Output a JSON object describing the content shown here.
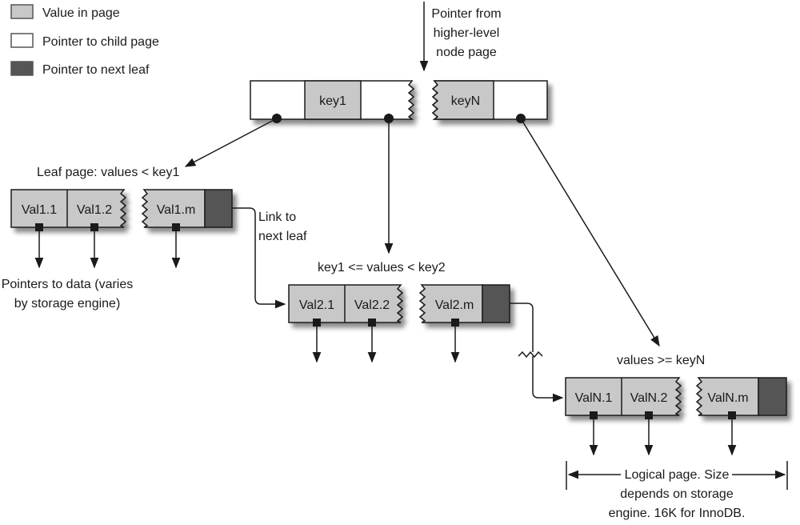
{
  "legend": {
    "items": [
      {
        "label": "Value in page",
        "swatch": "#c8c8c8"
      },
      {
        "label": "Pointer to child page",
        "swatch": "#ffffff"
      },
      {
        "label": "Pointer to next leaf",
        "swatch": "#555555"
      }
    ]
  },
  "colors": {
    "value_fill": "#c8c8c8",
    "pointer_fill": "#ffffff",
    "next_leaf_fill": "#555555",
    "stroke": "#1a1a1a"
  },
  "root": {
    "incoming_label": [
      "Pointer from",
      "higher-level",
      "node page"
    ],
    "keys": [
      "key1",
      "keyN"
    ]
  },
  "leaves": [
    {
      "title": "Leaf page: values < key1",
      "values": [
        "Val1.1",
        "Val1.2",
        "Val1.m"
      ]
    },
    {
      "title": "key1 <= values < key2",
      "values": [
        "Val2.1",
        "Val2.2",
        "Val2.m"
      ]
    },
    {
      "title": "values >= keyN",
      "values": [
        "ValN.1",
        "ValN.2",
        "ValN.m"
      ]
    }
  ],
  "annotations": {
    "link_next_leaf": [
      "Link to",
      "next leaf"
    ],
    "pointers_to_data": [
      "Pointers to data (varies",
      "by storage engine)"
    ],
    "logical_page": [
      "Logical page. Size",
      "depends on storage",
      "engine. 16K for InnoDB."
    ]
  }
}
